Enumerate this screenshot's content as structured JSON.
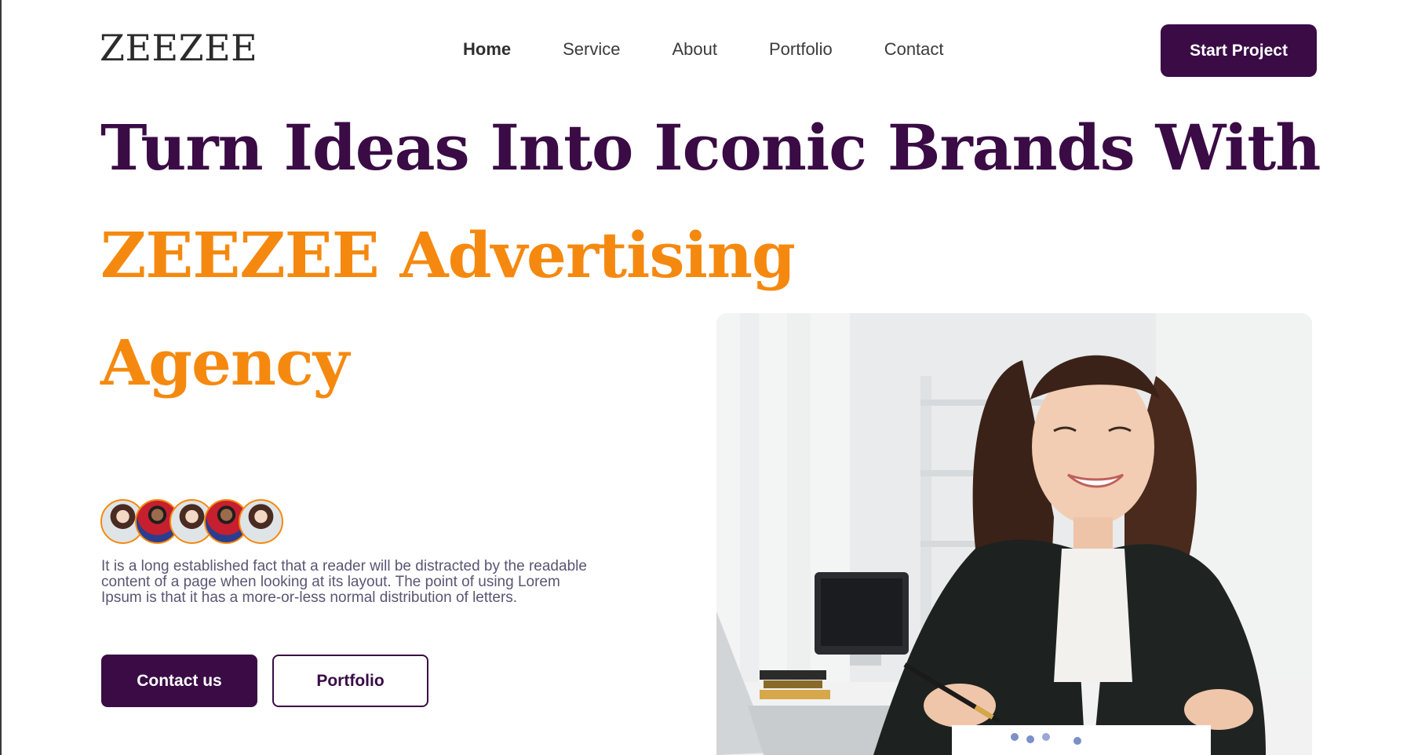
{
  "brand": {
    "logo_text": "ZEEZEE"
  },
  "nav": {
    "items": [
      {
        "label": "Home",
        "active": true
      },
      {
        "label": "Service",
        "active": false
      },
      {
        "label": "About",
        "active": false
      },
      {
        "label": "Portfolio",
        "active": false
      },
      {
        "label": "Contact",
        "active": false
      }
    ]
  },
  "header": {
    "cta_label": "Start Project"
  },
  "hero": {
    "headline_line1": "Turn Ideas Into Iconic Brands With",
    "headline_line2": "ZEEZEE Advertising",
    "headline_line3": "Agency",
    "description": "It is a long established fact that a reader will be distracted by the readable content of a page when looking at its layout. The point of using Lorem Ipsum is that it has a more-or-less normal distribution of letters.",
    "primary_button": "Contact us",
    "secondary_button": "Portfolio",
    "avatar_count": 5
  },
  "colors": {
    "brand_purple": "#3a0b45",
    "brand_orange": "#f5890f",
    "text_gray": "#5b5574"
  },
  "icons": [
    "avatar",
    "hero-photo"
  ]
}
